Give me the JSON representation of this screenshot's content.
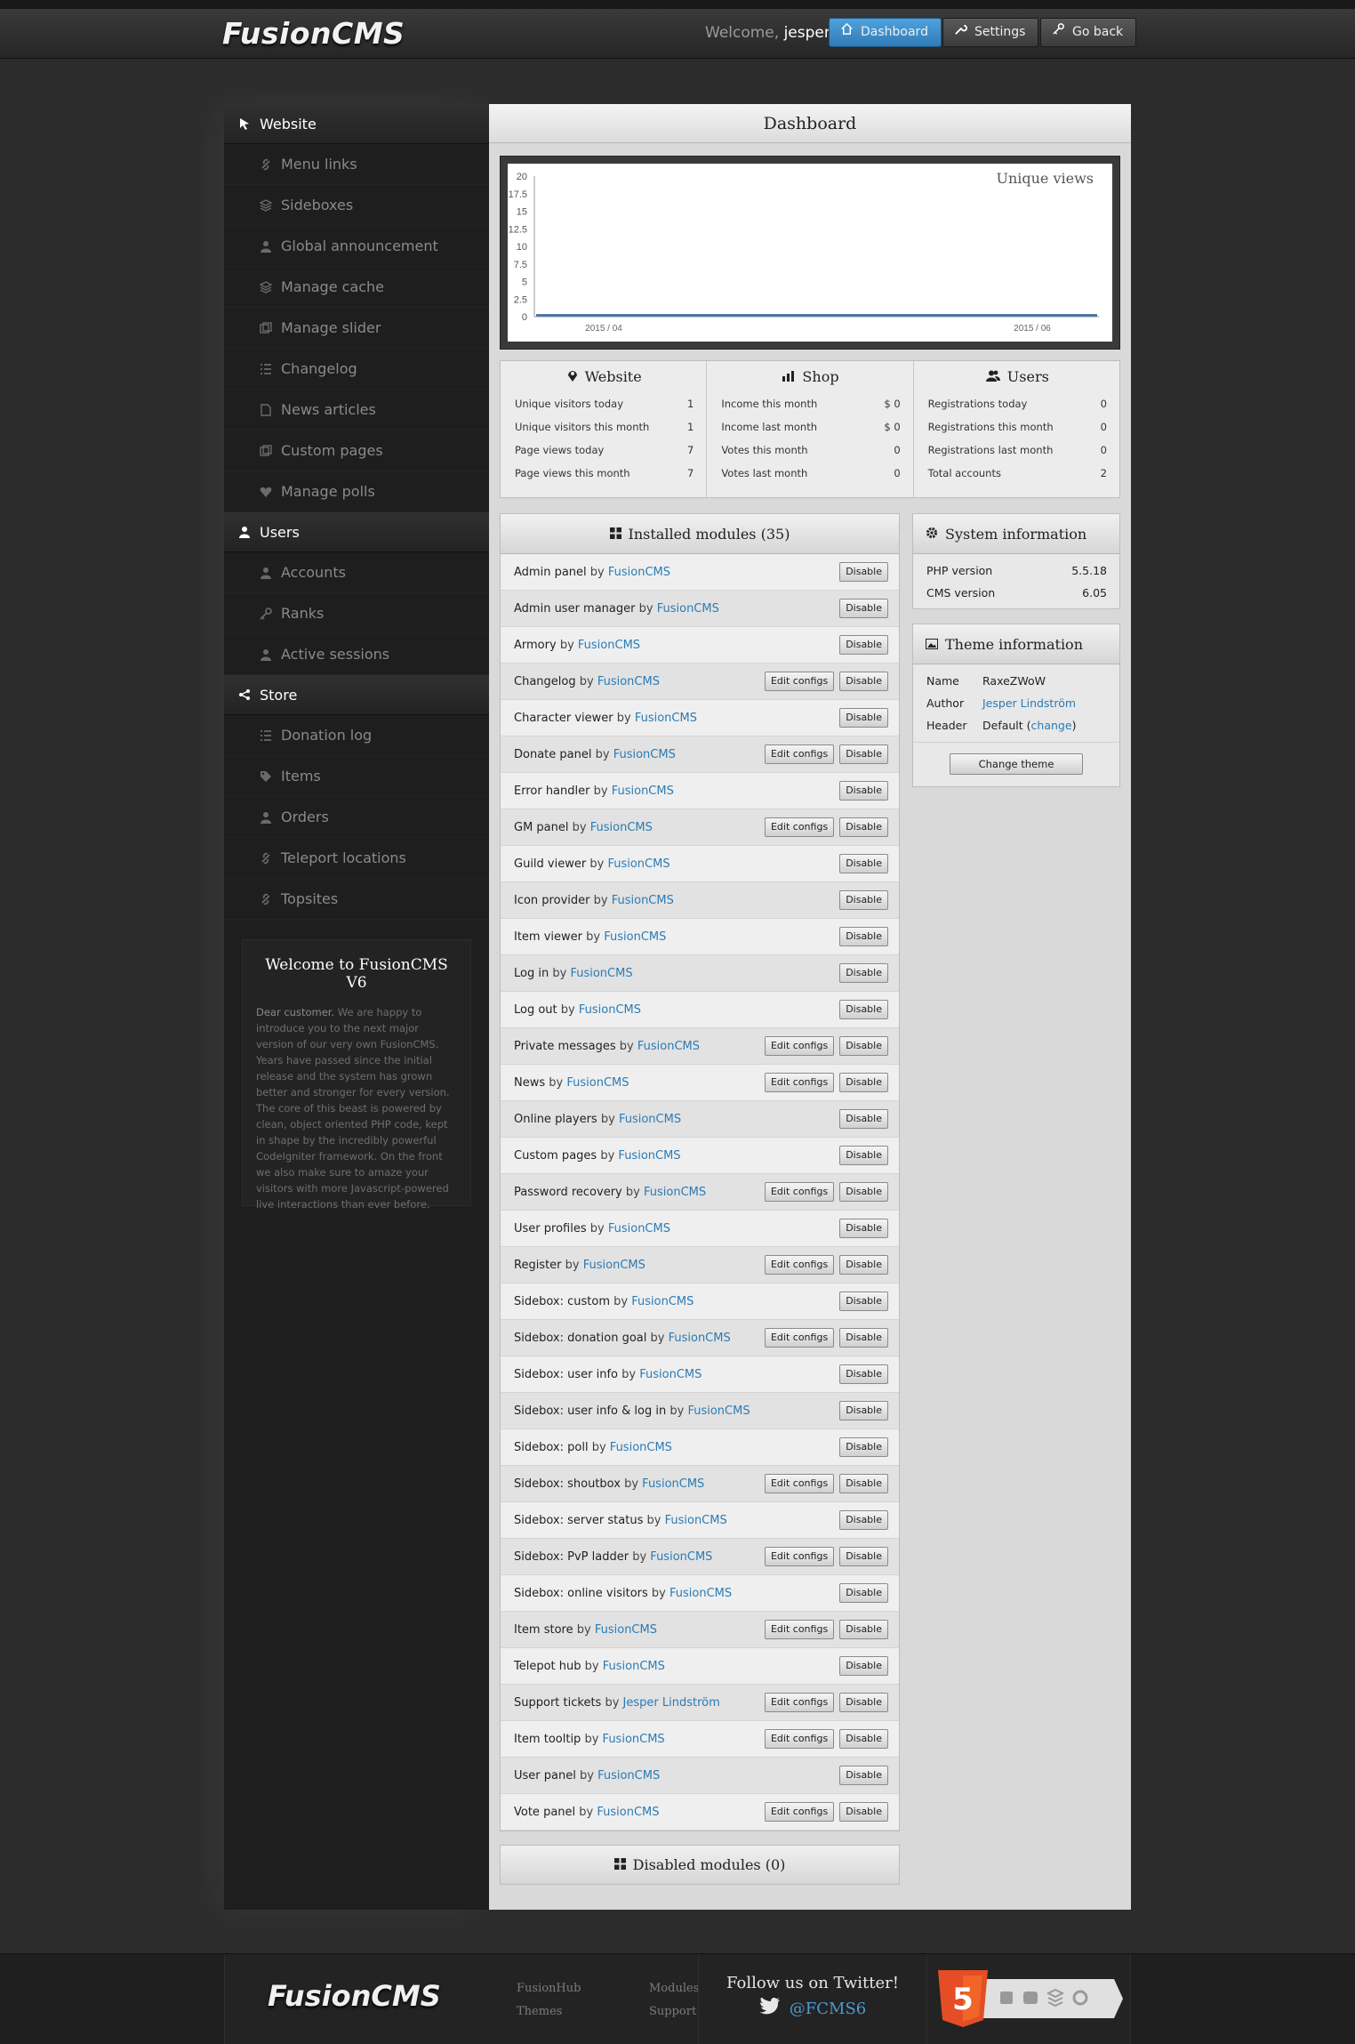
{
  "header": {
    "logo": "FusionCMS",
    "welcome_prefix": "Welcome,",
    "username": "jesper",
    "buttons": [
      {
        "label": "Dashboard",
        "icon": "home-icon",
        "active": true
      },
      {
        "label": "Settings",
        "icon": "wrench-icon",
        "active": false
      },
      {
        "label": "Go back",
        "icon": "key-icon",
        "active": false
      }
    ]
  },
  "sidebar": {
    "sections": [
      {
        "title": "Website",
        "icon": "cursor-icon",
        "items": [
          {
            "label": "Menu links",
            "icon": "link-icon"
          },
          {
            "label": "Sideboxes",
            "icon": "stack-icon"
          },
          {
            "label": "Global announcement",
            "icon": "user-icon"
          },
          {
            "label": "Manage cache",
            "icon": "stack-icon"
          },
          {
            "label": "Manage slider",
            "icon": "gallery-icon"
          },
          {
            "label": "Changelog",
            "icon": "list-icon"
          },
          {
            "label": "News articles",
            "icon": "document-icon"
          },
          {
            "label": "Custom pages",
            "icon": "gallery-icon"
          },
          {
            "label": "Manage polls",
            "icon": "heart-icon"
          }
        ]
      },
      {
        "title": "Users",
        "icon": "user-icon",
        "items": [
          {
            "label": "Accounts",
            "icon": "user-icon"
          },
          {
            "label": "Ranks",
            "icon": "key-icon"
          },
          {
            "label": "Active sessions",
            "icon": "user-icon"
          }
        ]
      },
      {
        "title": "Store",
        "icon": "share-icon",
        "items": [
          {
            "label": "Donation log",
            "icon": "list-icon"
          },
          {
            "label": "Items",
            "icon": "tag-icon"
          },
          {
            "label": "Orders",
            "icon": "user-icon"
          },
          {
            "label": "Teleport locations",
            "icon": "link-icon"
          },
          {
            "label": "Topsites",
            "icon": "link-icon"
          }
        ]
      }
    ],
    "welcome": {
      "title": "Welcome to FusionCMS V6",
      "lead": "Dear customer.",
      "body": "We are happy to introduce you to the next major version of our very own FusionCMS. Years have passed since the initial release and the system has grown better and stronger for every version. The core of this beast is powered by clean, object oriented PHP code, kept in shape by the incredibly powerful CodeIgniter framework. On the front we also make sure to amaze your visitors with more Javascript-powered live interactions than ever before."
    }
  },
  "content": {
    "title": "Dashboard"
  },
  "chart_data": {
    "type": "line",
    "title": "Unique views",
    "x": [
      "2015 / 04",
      "2015 / 06"
    ],
    "series": [
      {
        "values": [
          0.2,
          0.2
        ]
      }
    ],
    "yticks": [
      "0",
      "2.5",
      "5",
      "7.5",
      "10",
      "12.5",
      "15",
      "17.5",
      "20"
    ],
    "ylim": [
      0,
      20
    ],
    "line_color": "#3f6ea6"
  },
  "stats": [
    {
      "title": "Website",
      "icon": "pin-icon",
      "rows": [
        {
          "label": "Unique visitors today",
          "value": "1"
        },
        {
          "label": "Unique visitors this month",
          "value": "1"
        },
        {
          "label": "Page views today",
          "value": "7"
        },
        {
          "label": "Page views this month",
          "value": "7"
        }
      ]
    },
    {
      "title": "Shop",
      "icon": "bar-chart-icon",
      "rows": [
        {
          "label": "Income this month",
          "value": "$ 0"
        },
        {
          "label": "Income last month",
          "value": "$ 0"
        },
        {
          "label": "Votes this month",
          "value": "0"
        },
        {
          "label": "Votes last month",
          "value": "0"
        }
      ]
    },
    {
      "title": "Users",
      "icon": "users-icon",
      "rows": [
        {
          "label": "Registrations today",
          "value": "0"
        },
        {
          "label": "Registrations this month",
          "value": "0"
        },
        {
          "label": "Registrations last month",
          "value": "0"
        },
        {
          "label": "Total accounts",
          "value": "2"
        }
      ]
    }
  ],
  "modules": {
    "title": "Installed modules (35)",
    "by_label": "by",
    "edit_label": "Edit configs",
    "disable_label": "Disable",
    "items": [
      {
        "name": "Admin panel",
        "author": "FusionCMS",
        "config": false
      },
      {
        "name": "Admin user manager",
        "author": "FusionCMS",
        "config": false
      },
      {
        "name": "Armory",
        "author": "FusionCMS",
        "config": false
      },
      {
        "name": "Changelog",
        "author": "FusionCMS",
        "config": true
      },
      {
        "name": "Character viewer",
        "author": "FusionCMS",
        "config": false
      },
      {
        "name": "Donate panel",
        "author": "FusionCMS",
        "config": true
      },
      {
        "name": "Error handler",
        "author": "FusionCMS",
        "config": false
      },
      {
        "name": "GM panel",
        "author": "FusionCMS",
        "config": true
      },
      {
        "name": "Guild viewer",
        "author": "FusionCMS",
        "config": false
      },
      {
        "name": "Icon provider",
        "author": "FusionCMS",
        "config": false
      },
      {
        "name": "Item viewer",
        "author": "FusionCMS",
        "config": false
      },
      {
        "name": "Log in",
        "author": "FusionCMS",
        "config": false
      },
      {
        "name": "Log out",
        "author": "FusionCMS",
        "config": false
      },
      {
        "name": "Private messages",
        "author": "FusionCMS",
        "config": true
      },
      {
        "name": "News",
        "author": "FusionCMS",
        "config": true
      },
      {
        "name": "Online players",
        "author": "FusionCMS",
        "config": false
      },
      {
        "name": "Custom pages",
        "author": "FusionCMS",
        "config": false
      },
      {
        "name": "Password recovery",
        "author": "FusionCMS",
        "config": true
      },
      {
        "name": "User profiles",
        "author": "FusionCMS",
        "config": false
      },
      {
        "name": "Register",
        "author": "FusionCMS",
        "config": true
      },
      {
        "name": "Sidebox: custom",
        "author": "FusionCMS",
        "config": false
      },
      {
        "name": "Sidebox: donation goal",
        "author": "FusionCMS",
        "config": true
      },
      {
        "name": "Sidebox: user info",
        "author": "FusionCMS",
        "config": false
      },
      {
        "name": "Sidebox: user info & log in",
        "author": "FusionCMS",
        "config": false
      },
      {
        "name": "Sidebox: poll",
        "author": "FusionCMS",
        "config": false
      },
      {
        "name": "Sidebox: shoutbox",
        "author": "FusionCMS",
        "config": true
      },
      {
        "name": "Sidebox: server status",
        "author": "FusionCMS",
        "config": false
      },
      {
        "name": "Sidebox: PvP ladder",
        "author": "FusionCMS",
        "config": true
      },
      {
        "name": "Sidebox: online visitors",
        "author": "FusionCMS",
        "config": false
      },
      {
        "name": "Item store",
        "author": "FusionCMS",
        "config": true
      },
      {
        "name": "Telepot hub",
        "author": "FusionCMS",
        "config": false
      },
      {
        "name": "Support tickets",
        "author": "Jesper Lindström",
        "config": true
      },
      {
        "name": "Item tooltip",
        "author": "FusionCMS",
        "config": true
      },
      {
        "name": "User panel",
        "author": "FusionCMS",
        "config": false
      },
      {
        "name": "Vote panel",
        "author": "FusionCMS",
        "config": true
      }
    ],
    "disabled_title": "Disabled modules (0)"
  },
  "system_info": {
    "title": "System information",
    "rows": [
      {
        "label": "PHP version",
        "value": "5.5.18"
      },
      {
        "label": "CMS version",
        "value": "6.05"
      }
    ]
  },
  "theme_info": {
    "title": "Theme information",
    "name_label": "Name",
    "name": "RaxeZWoW",
    "author_label": "Author",
    "author": "Jesper Lindström",
    "header_label": "Header",
    "header": "Default",
    "header_link": "change",
    "button": "Change theme"
  },
  "footer": {
    "logo": "FusionCMS",
    "links_col1": [
      "FusionHub",
      "Themes"
    ],
    "links_col2": [
      "Modules",
      "Support"
    ],
    "twitter_title": "Follow us on Twitter!",
    "twitter_handle": "@FCMS6",
    "html5_label": "5"
  }
}
